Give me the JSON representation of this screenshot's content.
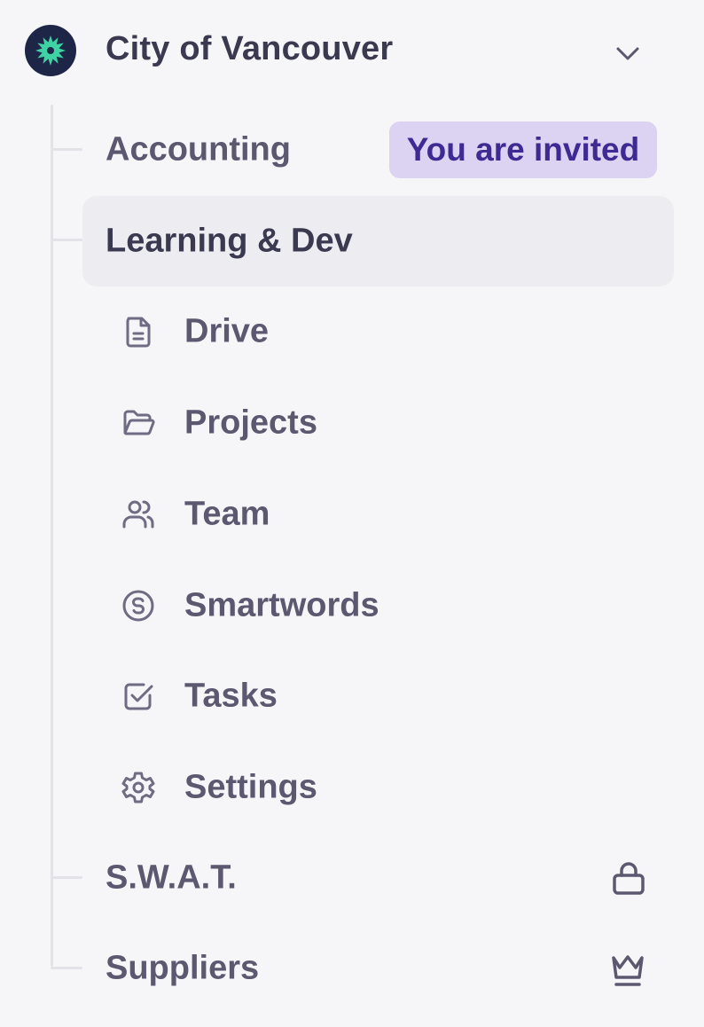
{
  "organization": {
    "name": "City of Vancouver",
    "logo_icon": "sun-logo-icon",
    "expand_icon": "chevron-down-icon"
  },
  "teams": [
    {
      "label": "Accounting",
      "badge": "You are invited"
    },
    {
      "label": "Learning & Dev",
      "active": true
    },
    {
      "label": "S.W.A.T.",
      "trailing_icon": "lock-icon"
    },
    {
      "label": "Suppliers",
      "trailing_icon": "crown-icon"
    }
  ],
  "subnav": [
    {
      "label": "Drive",
      "icon": "document-icon"
    },
    {
      "label": "Projects",
      "icon": "folder-open-icon"
    },
    {
      "label": "Team",
      "icon": "users-icon"
    },
    {
      "label": "Smartwords",
      "icon": "smartwords-coin-icon"
    },
    {
      "label": "Tasks",
      "icon": "checkbox-icon"
    },
    {
      "label": "Settings",
      "icon": "gear-icon"
    }
  ],
  "colors": {
    "background": "#F6F6F9",
    "active_row": "#EDEDF1",
    "badge_bg": "#DCD2F2",
    "badge_text": "#3F2A93",
    "logo_bg": "#1D2646",
    "logo_accent": "#3FD3A4",
    "text": "#5B5870"
  }
}
